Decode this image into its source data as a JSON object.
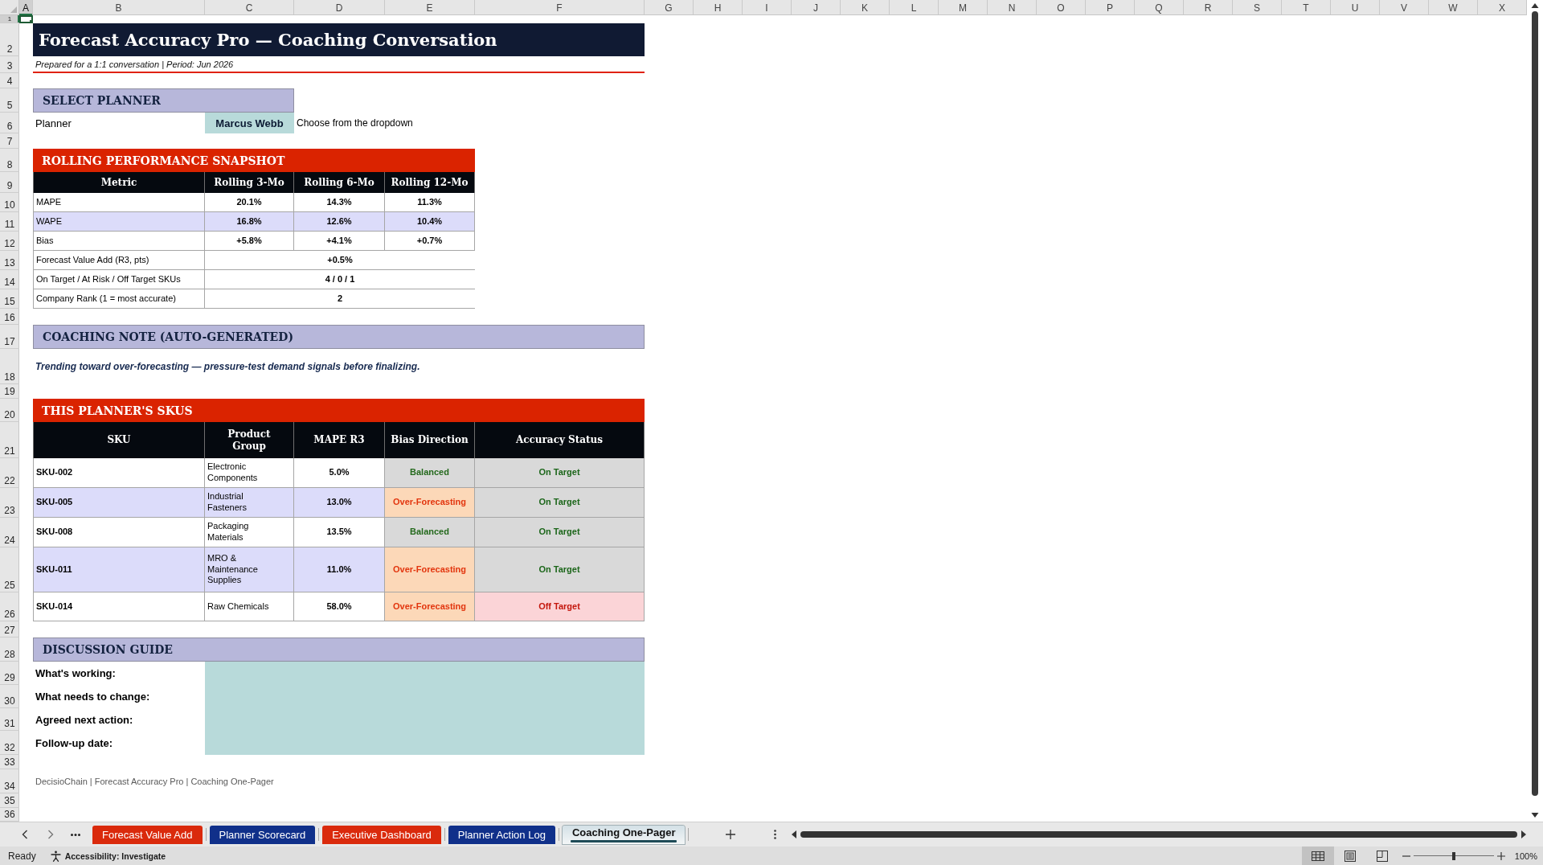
{
  "column_headers": [
    {
      "label": "A",
      "selected": true
    },
    {
      "label": "B",
      "selected": false
    },
    {
      "label": "C",
      "selected": false
    },
    {
      "label": "D",
      "selected": false
    },
    {
      "label": "E",
      "selected": false
    },
    {
      "label": "F",
      "selected": false
    },
    {
      "label": "G",
      "selected": false
    },
    {
      "label": "H",
      "selected": false
    },
    {
      "label": "I",
      "selected": false
    },
    {
      "label": "J",
      "selected": false
    },
    {
      "label": "K",
      "selected": false
    },
    {
      "label": "L",
      "selected": false
    },
    {
      "label": "M",
      "selected": false
    },
    {
      "label": "N",
      "selected": false
    },
    {
      "label": "O",
      "selected": false
    },
    {
      "label": "P",
      "selected": false
    },
    {
      "label": "Q",
      "selected": false
    },
    {
      "label": "R",
      "selected": false
    },
    {
      "label": "S",
      "selected": false
    },
    {
      "label": "T",
      "selected": false
    },
    {
      "label": "U",
      "selected": false
    },
    {
      "label": "V",
      "selected": false
    },
    {
      "label": "W",
      "selected": false
    },
    {
      "label": "X",
      "selected": false
    }
  ],
  "row_headers": [
    {
      "label": "1",
      "selected": true
    },
    {
      "label": "2",
      "selected": false
    },
    {
      "label": "3",
      "selected": false
    },
    {
      "label": "4",
      "selected": false
    },
    {
      "label": "5",
      "selected": false
    },
    {
      "label": "6",
      "selected": false
    },
    {
      "label": "7",
      "selected": false
    },
    {
      "label": "8",
      "selected": false
    },
    {
      "label": "9",
      "selected": false
    },
    {
      "label": "10",
      "selected": false
    },
    {
      "label": "11",
      "selected": false
    },
    {
      "label": "12",
      "selected": false
    },
    {
      "label": "13",
      "selected": false
    },
    {
      "label": "14",
      "selected": false
    },
    {
      "label": "15",
      "selected": false
    },
    {
      "label": "16",
      "selected": false
    },
    {
      "label": "17",
      "selected": false
    },
    {
      "label": "18",
      "selected": false
    },
    {
      "label": "19",
      "selected": false
    },
    {
      "label": "20",
      "selected": false
    },
    {
      "label": "21",
      "selected": false
    },
    {
      "label": "22",
      "selected": false
    },
    {
      "label": "23",
      "selected": false
    },
    {
      "label": "24",
      "selected": false
    },
    {
      "label": "25",
      "selected": false
    },
    {
      "label": "26",
      "selected": false
    },
    {
      "label": "27",
      "selected": false
    },
    {
      "label": "28",
      "selected": false
    },
    {
      "label": "29",
      "selected": false
    },
    {
      "label": "30",
      "selected": false
    },
    {
      "label": "31",
      "selected": false
    },
    {
      "label": "32",
      "selected": false
    },
    {
      "label": "33",
      "selected": false
    },
    {
      "label": "34",
      "selected": false
    },
    {
      "label": "35",
      "selected": false
    },
    {
      "label": "36",
      "selected": false
    }
  ],
  "title": "Forecast Accuracy Pro — Coaching Conversation",
  "subtitle": "Prepared for a 1:1 conversation | Period: Jun 2026",
  "select_planner": {
    "heading": "SELECT PLANNER",
    "label": "Planner",
    "value": "Marcus Webb",
    "hint": "Choose from the dropdown"
  },
  "snapshot": {
    "heading": "ROLLING PERFORMANCE SNAPSHOT",
    "columns": [
      "Metric",
      "Rolling 3-Mo",
      "Rolling 6-Mo",
      "Rolling 12-Mo"
    ],
    "rows": [
      {
        "metric": "MAPE",
        "values": [
          "20.1%",
          "14.3%",
          "11.3%"
        ]
      },
      {
        "metric": "WAPE",
        "values": [
          "16.8%",
          "12.6%",
          "10.4%"
        ]
      },
      {
        "metric": "Bias",
        "values": [
          "+5.8%",
          "+4.1%",
          "+0.7%"
        ]
      }
    ],
    "summary": [
      {
        "label": "Forecast Value Add (R3, pts)",
        "value": "+0.5%"
      },
      {
        "label": "On Target / At Risk / Off Target SKUs",
        "value": "4 / 0 / 1"
      },
      {
        "label": "Company Rank (1 = most accurate)",
        "value": "2"
      }
    ]
  },
  "coaching_note": {
    "heading": "COACHING NOTE (AUTO-GENERATED)",
    "text": "Trending toward over-forecasting — pressure-test demand signals before finalizing."
  },
  "skus": {
    "heading": "THIS PLANNER'S SKUS",
    "columns": [
      "SKU",
      "Product Group",
      "MAPE R3",
      "Bias Direction",
      "Accuracy Status"
    ],
    "rows": [
      {
        "sku": "SKU-002",
        "product_group": "Electronic Components",
        "mape_r3": "5.0%",
        "bias_direction": {
          "text": "Balanced",
          "kind": "balanced"
        },
        "accuracy_status": {
          "text": "On Target",
          "kind": "on_target"
        }
      },
      {
        "sku": "SKU-005",
        "product_group": "Industrial Fasteners",
        "mape_r3": "13.0%",
        "bias_direction": {
          "text": "Over-Forecasting",
          "kind": "over_forecasting"
        },
        "accuracy_status": {
          "text": "On Target",
          "kind": "on_target"
        }
      },
      {
        "sku": "SKU-008",
        "product_group": "Packaging Materials",
        "mape_r3": "13.5%",
        "bias_direction": {
          "text": "Balanced",
          "kind": "balanced"
        },
        "accuracy_status": {
          "text": "On Target",
          "kind": "on_target"
        }
      },
      {
        "sku": "SKU-011",
        "product_group": "MRO & Maintenance Supplies",
        "mape_r3": "11.0%",
        "bias_direction": {
          "text": "Over-Forecasting",
          "kind": "over_forecasting"
        },
        "accuracy_status": {
          "text": "On Target",
          "kind": "on_target"
        }
      },
      {
        "sku": "SKU-014",
        "product_group": "Raw Chemicals",
        "mape_r3": "58.0%",
        "bias_direction": {
          "text": "Over-Forecasting",
          "kind": "over_forecasting"
        },
        "accuracy_status": {
          "text": "Off Target",
          "kind": "off_target"
        }
      }
    ]
  },
  "discussion_guide": {
    "heading": "DISCUSSION GUIDE",
    "prompts": [
      "What's working:",
      "What needs to change:",
      "Agreed next action:",
      "Follow-up date:"
    ]
  },
  "footer": "DecisioChain | Forecast Accuracy Pro | Coaching One-Pager",
  "sheet_tabs": [
    {
      "label": "Forecast Value Add",
      "color": "#da2a0c",
      "selected": false
    },
    {
      "label": "Planner Scorecard",
      "color": "#10308a",
      "selected": false
    },
    {
      "label": "Executive Dashboard",
      "color": "#da2a0c",
      "selected": false
    },
    {
      "label": "Planner Action Log",
      "color": "#10308a",
      "selected": false
    },
    {
      "label": "Coaching One-Pager",
      "color": "#1e4b57",
      "selected": true
    }
  ],
  "status_bar": {
    "mode": "Ready",
    "accessibility": "Accessibility: Investigate",
    "view_buttons": [
      {
        "kind": "normal",
        "selected": true
      },
      {
        "kind": "page_layout",
        "selected": false
      },
      {
        "kind": "page_break",
        "selected": false
      }
    ],
    "zoom_slider": {
      "level": 0.5
    },
    "zoom": "100%"
  }
}
